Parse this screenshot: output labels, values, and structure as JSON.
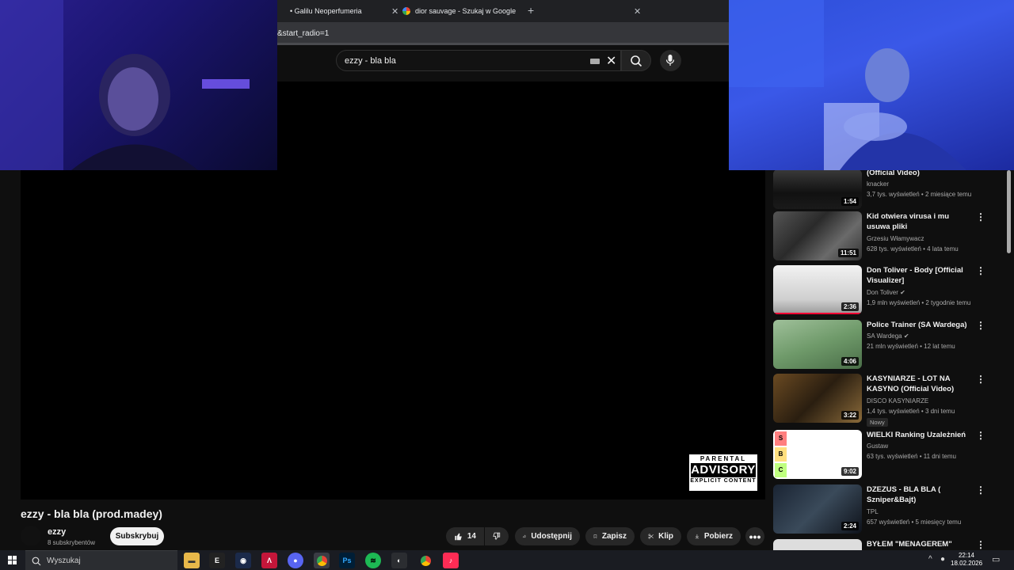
{
  "browser": {
    "tabs": [
      {
        "label": "• Galilu Neoperfumeria"
      },
      {
        "label": "dior sauvage - Szukaj w Google"
      }
    ],
    "url_fragment": "&start_radio=1"
  },
  "search": {
    "query": "ezzy - bla bla"
  },
  "video": {
    "title": "ezzy - bla bla (prod.madey)",
    "advisory": {
      "line1": "PARENTAL",
      "line2": "ADVISORY",
      "line3": "EXPLICIT CONTENT"
    }
  },
  "channel": {
    "name": "ezzy",
    "subscribers": "8 subskrybentów",
    "subscribe_label": "Subskrybuj"
  },
  "actions": {
    "like_count": "14",
    "share_label": "Udostępnij",
    "save_label": "Zapisz",
    "clip_label": "Klip",
    "download_label": "Pobierz"
  },
  "recommendations": [
    {
      "title": "(Official Video)",
      "channel": "knacker",
      "meta": "3,7 tys. wyświetleń • 2 miesiące temu",
      "duration": "1:54"
    },
    {
      "title": "Kid otwiera virusa i mu usuwa pliki",
      "channel": "Grzesiu Włamywacz",
      "meta": "628 tys. wyświetleń • 4 lata temu",
      "duration": "11:51"
    },
    {
      "title": "Don Toliver - Body [Official Visualizer]",
      "channel": "Don Toliver",
      "meta": "1,9 mln wyświetleń • 2 tygodnie temu",
      "duration": "2:36"
    },
    {
      "title": "Police Trainer (SA Wardega)",
      "channel": "SA Wardega",
      "meta": "21 mln wyświetleń • 12 lat temu",
      "duration": "4:06"
    },
    {
      "title": "KASYNIARZE - LOT NA KASYNO (Official Video)",
      "channel": "DISCO KASYNIARZE",
      "meta": "1,4 tys. wyświetleń • 3 dni temu",
      "duration": "3:22",
      "badge": "Nowy"
    },
    {
      "title": "WIELKI Ranking Uzależnień",
      "channel": "Gustaw",
      "meta": "63 tys. wyświetleń • 11 dni temu",
      "duration": "9:02"
    },
    {
      "title": "DZEZUS - BLA BLA ( Szniper&Bajt)",
      "channel": "TPL",
      "meta": "657 wyświetleń • 5 miesięcy temu",
      "duration": "2:24"
    },
    {
      "title": "BYŁEM \"MENAGEREM\"",
      "channel": "",
      "meta": "",
      "duration": ""
    }
  ],
  "taskbar": {
    "search_placeholder": "Wyszukaj",
    "time": "22:14",
    "date": "18.02.2026"
  }
}
